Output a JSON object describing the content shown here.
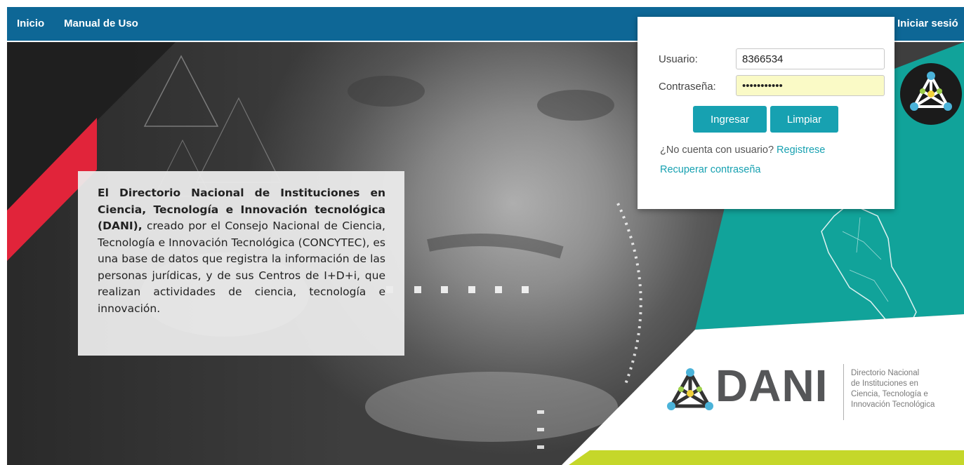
{
  "nav": {
    "home": "Inicio",
    "manual": "Manual de Uso",
    "login": "Iniciar sesió"
  },
  "hero": {
    "intro_bold": "El Directorio Nacional de Instituciones en Ciencia, Tecnología e Innovación tecnológica (DANI),",
    "intro_rest": "creado por el Consejo Nacional de Ciencia, Tecnología e Innovación Tecnológica (CONCYTEC), es una base de datos que registra la información de las personas jurídicas, y de sus Centros de I+D+i, que realizan actividades de ciencia, tecnología e innovación."
  },
  "login": {
    "user_label": "Usuario:",
    "user_value": "8366534",
    "password_label": "Contraseña:",
    "password_value": "password123",
    "submit_label": "Ingresar",
    "clear_label": "Limpiar",
    "no_account_text": "¿No cuenta con usuario?",
    "register_link": "Registrese",
    "recover_link": "Recuperar contraseña"
  },
  "logo": {
    "wordmark": "DANI",
    "tagline_line1": "Directorio Nacional",
    "tagline_line2": "de Instituciones en",
    "tagline_line3": "Ciencia, Tecnología e",
    "tagline_line4": "Innovación Tecnológica"
  },
  "colors": {
    "navbar": "#0e6796",
    "teal": "#17a1b1",
    "accent_red": "#e1243a",
    "lime": "#c5d72a",
    "logo_gray": "#555658"
  },
  "icons": {
    "network_badge": "network-triangle-icon",
    "logo_mark": "network-triangle-icon",
    "map": "peru-map-icon"
  }
}
